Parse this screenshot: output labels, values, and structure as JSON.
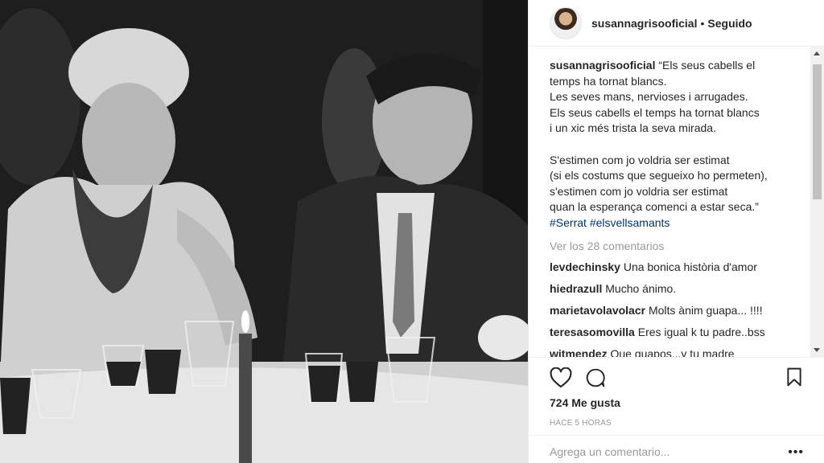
{
  "post": {
    "author": "susannagrisooficial",
    "separator": "•",
    "follow_status": "Seguido",
    "caption_lines": [
      "“Els seus cabells el",
      "temps ha tornat blancs.",
      "Les seves mans, nervioses i arrugades.",
      "Els seus cabells el temps ha tornat blancs",
      "i un xic més trista la seva mirada.",
      "",
      "S'estimen com jo voldria ser estimat",
      "(si els costums que segueixo ho permeten),",
      "s'estimen com jo voldria ser estimat",
      "quan la esperança comenci a estar seca.”"
    ],
    "hashtags": [
      "#Serrat",
      "#elsvellsamants"
    ],
    "view_all_comments": "Ver los 28 comentarios",
    "comments": [
      {
        "user": "levdechinsky",
        "text": "Una bonica història d'amor"
      },
      {
        "user": "hiedrazull",
        "text": "Mucho ánimo."
      },
      {
        "user": "marietavolavolacr",
        "text": "Molts ànim guapa... !!!!"
      },
      {
        "user": "teresasomovilla",
        "text": "Eres igual k tu padre..bss"
      },
      {
        "user": "witmendez",
        "text": "Que guapos...y tu madre"
      }
    ],
    "likes": "724 Me gusta",
    "timestamp": "HACE 5 HORAS",
    "comment_placeholder": "Agrega un comentario...",
    "more_options": "•••"
  },
  "icons": {
    "like": "heart-icon",
    "comment": "comment-icon",
    "save": "bookmark-icon"
  },
  "colors": {
    "text": "#262626",
    "muted": "#999999",
    "hashtag": "#003569",
    "border": "#efefef"
  }
}
